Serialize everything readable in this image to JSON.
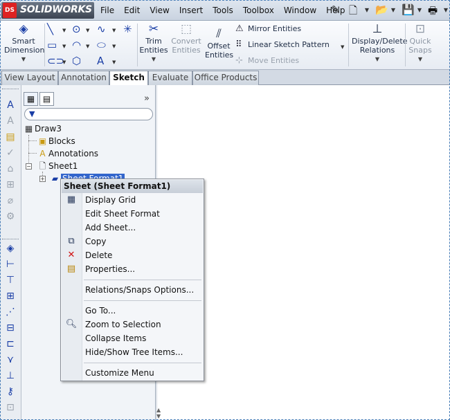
{
  "app": {
    "logo_badge": "DS",
    "logo_text": "SOLIDWORKS"
  },
  "menubar": {
    "items": [
      "File",
      "Edit",
      "View",
      "Insert",
      "Tools",
      "Toolbox",
      "Window",
      "Help"
    ]
  },
  "quick_access": [
    {
      "icon": "pin-icon"
    },
    {
      "icon": "new-document-icon"
    },
    {
      "icon": "open-folder-icon"
    },
    {
      "icon": "save-icon"
    },
    {
      "icon": "print-icon"
    }
  ],
  "command_manager": {
    "smart_dimension": "Smart Dimension",
    "trim_entities": "Trim Entities",
    "convert_entities": "Convert Entities",
    "offset_entities": "Offset Entities",
    "mirror_entities": "Mirror Entities",
    "linear_sketch_pattern": "Linear Sketch Pattern",
    "move_entities": "Move Entities",
    "display_delete_relations": "Display/Delete Relations",
    "quick_snaps": "Quick Snaps"
  },
  "tabs": [
    "View Layout",
    "Annotation",
    "Sketch",
    "Evaluate",
    "Office Products"
  ],
  "active_tab": "Sketch",
  "feature_tree": {
    "root": "Draw3",
    "blocks": "Blocks",
    "annotations": "Annotations",
    "sheet": "Sheet1",
    "sheet_format": "Sheet Format1"
  },
  "context_menu": {
    "header": "Sheet (Sheet Format1)",
    "items": [
      {
        "label": "Display Grid",
        "icon": "grid-icon"
      },
      {
        "label": "Edit Sheet Format",
        "icon": ""
      },
      {
        "label": "Add Sheet...",
        "icon": ""
      },
      {
        "label": "Copy",
        "icon": "copy-icon"
      },
      {
        "label": "Delete",
        "icon": "delete-icon"
      },
      {
        "label": "Properties...",
        "icon": "properties-icon"
      },
      {
        "label": "Relations/Snaps Options...",
        "icon": ""
      },
      {
        "label": "Go To...",
        "icon": ""
      },
      {
        "label": "Zoom to Selection",
        "icon": "zoom-icon"
      },
      {
        "label": "Collapse Items",
        "icon": ""
      },
      {
        "label": "Hide/Show Tree Items...",
        "icon": ""
      },
      {
        "label": "Customize Menu",
        "icon": ""
      }
    ]
  },
  "colors": {
    "accent": "#1a3ea6",
    "selection": "#3366cc",
    "delete": "#d01010"
  }
}
